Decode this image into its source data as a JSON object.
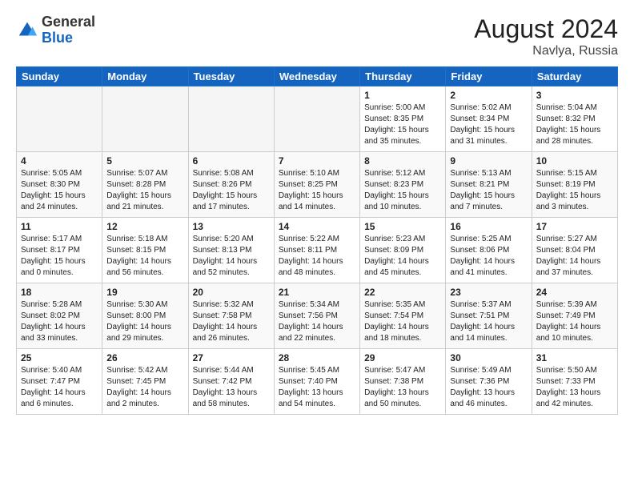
{
  "header": {
    "logo_general": "General",
    "logo_blue": "Blue",
    "month": "August 2024",
    "location": "Navlya, Russia"
  },
  "weekdays": [
    "Sunday",
    "Monday",
    "Tuesday",
    "Wednesday",
    "Thursday",
    "Friday",
    "Saturday"
  ],
  "weeks": [
    [
      {
        "day": "",
        "info": ""
      },
      {
        "day": "",
        "info": ""
      },
      {
        "day": "",
        "info": ""
      },
      {
        "day": "",
        "info": ""
      },
      {
        "day": "1",
        "info": "Sunrise: 5:00 AM\nSunset: 8:35 PM\nDaylight: 15 hours\nand 35 minutes."
      },
      {
        "day": "2",
        "info": "Sunrise: 5:02 AM\nSunset: 8:34 PM\nDaylight: 15 hours\nand 31 minutes."
      },
      {
        "day": "3",
        "info": "Sunrise: 5:04 AM\nSunset: 8:32 PM\nDaylight: 15 hours\nand 28 minutes."
      }
    ],
    [
      {
        "day": "4",
        "info": "Sunrise: 5:05 AM\nSunset: 8:30 PM\nDaylight: 15 hours\nand 24 minutes."
      },
      {
        "day": "5",
        "info": "Sunrise: 5:07 AM\nSunset: 8:28 PM\nDaylight: 15 hours\nand 21 minutes."
      },
      {
        "day": "6",
        "info": "Sunrise: 5:08 AM\nSunset: 8:26 PM\nDaylight: 15 hours\nand 17 minutes."
      },
      {
        "day": "7",
        "info": "Sunrise: 5:10 AM\nSunset: 8:25 PM\nDaylight: 15 hours\nand 14 minutes."
      },
      {
        "day": "8",
        "info": "Sunrise: 5:12 AM\nSunset: 8:23 PM\nDaylight: 15 hours\nand 10 minutes."
      },
      {
        "day": "9",
        "info": "Sunrise: 5:13 AM\nSunset: 8:21 PM\nDaylight: 15 hours\nand 7 minutes."
      },
      {
        "day": "10",
        "info": "Sunrise: 5:15 AM\nSunset: 8:19 PM\nDaylight: 15 hours\nand 3 minutes."
      }
    ],
    [
      {
        "day": "11",
        "info": "Sunrise: 5:17 AM\nSunset: 8:17 PM\nDaylight: 15 hours\nand 0 minutes."
      },
      {
        "day": "12",
        "info": "Sunrise: 5:18 AM\nSunset: 8:15 PM\nDaylight: 14 hours\nand 56 minutes."
      },
      {
        "day": "13",
        "info": "Sunrise: 5:20 AM\nSunset: 8:13 PM\nDaylight: 14 hours\nand 52 minutes."
      },
      {
        "day": "14",
        "info": "Sunrise: 5:22 AM\nSunset: 8:11 PM\nDaylight: 14 hours\nand 48 minutes."
      },
      {
        "day": "15",
        "info": "Sunrise: 5:23 AM\nSunset: 8:09 PM\nDaylight: 14 hours\nand 45 minutes."
      },
      {
        "day": "16",
        "info": "Sunrise: 5:25 AM\nSunset: 8:06 PM\nDaylight: 14 hours\nand 41 minutes."
      },
      {
        "day": "17",
        "info": "Sunrise: 5:27 AM\nSunset: 8:04 PM\nDaylight: 14 hours\nand 37 minutes."
      }
    ],
    [
      {
        "day": "18",
        "info": "Sunrise: 5:28 AM\nSunset: 8:02 PM\nDaylight: 14 hours\nand 33 minutes."
      },
      {
        "day": "19",
        "info": "Sunrise: 5:30 AM\nSunset: 8:00 PM\nDaylight: 14 hours\nand 29 minutes."
      },
      {
        "day": "20",
        "info": "Sunrise: 5:32 AM\nSunset: 7:58 PM\nDaylight: 14 hours\nand 26 minutes."
      },
      {
        "day": "21",
        "info": "Sunrise: 5:34 AM\nSunset: 7:56 PM\nDaylight: 14 hours\nand 22 minutes."
      },
      {
        "day": "22",
        "info": "Sunrise: 5:35 AM\nSunset: 7:54 PM\nDaylight: 14 hours\nand 18 minutes."
      },
      {
        "day": "23",
        "info": "Sunrise: 5:37 AM\nSunset: 7:51 PM\nDaylight: 14 hours\nand 14 minutes."
      },
      {
        "day": "24",
        "info": "Sunrise: 5:39 AM\nSunset: 7:49 PM\nDaylight: 14 hours\nand 10 minutes."
      }
    ],
    [
      {
        "day": "25",
        "info": "Sunrise: 5:40 AM\nSunset: 7:47 PM\nDaylight: 14 hours\nand 6 minutes."
      },
      {
        "day": "26",
        "info": "Sunrise: 5:42 AM\nSunset: 7:45 PM\nDaylight: 14 hours\nand 2 minutes."
      },
      {
        "day": "27",
        "info": "Sunrise: 5:44 AM\nSunset: 7:42 PM\nDaylight: 13 hours\nand 58 minutes."
      },
      {
        "day": "28",
        "info": "Sunrise: 5:45 AM\nSunset: 7:40 PM\nDaylight: 13 hours\nand 54 minutes."
      },
      {
        "day": "29",
        "info": "Sunrise: 5:47 AM\nSunset: 7:38 PM\nDaylight: 13 hours\nand 50 minutes."
      },
      {
        "day": "30",
        "info": "Sunrise: 5:49 AM\nSunset: 7:36 PM\nDaylight: 13 hours\nand 46 minutes."
      },
      {
        "day": "31",
        "info": "Sunrise: 5:50 AM\nSunset: 7:33 PM\nDaylight: 13 hours\nand 42 minutes."
      }
    ]
  ]
}
